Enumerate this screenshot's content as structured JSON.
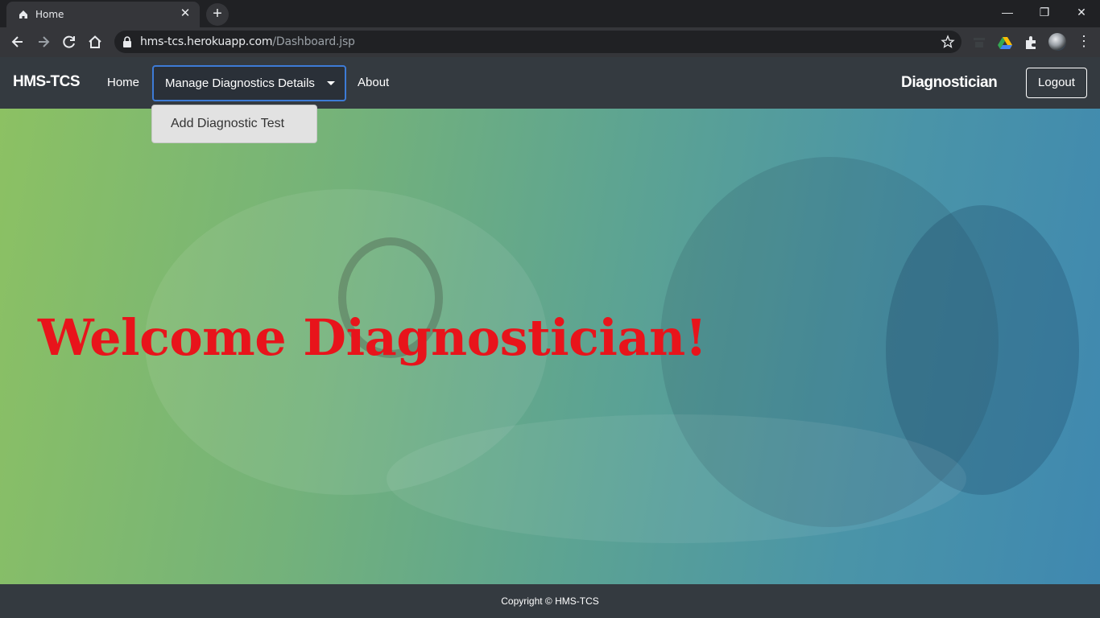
{
  "browser": {
    "tab_title": "Home",
    "url_host": "hms-tcs.herokuapp.com",
    "url_path": "/Dashboard.jsp",
    "icons": [
      "home-icon",
      "close-icon",
      "plus-icon",
      "back-icon",
      "forward-icon",
      "reload-icon",
      "lock-icon",
      "star-icon",
      "extensions-icon",
      "profile-icon"
    ]
  },
  "navbar": {
    "brand": "HMS-TCS",
    "home": "Home",
    "manage_dropdown": "Manage Diagnostics Details",
    "about": "About",
    "role": "Diagnostician",
    "logout": "Logout"
  },
  "dropdown_menu": {
    "items": [
      "Add Diagnostic Test"
    ]
  },
  "hero": {
    "welcome": "Welcome Diagnostician!",
    "welcome_color": "#e8141b"
  },
  "footer": {
    "copyright": "Copyright © HMS-TCS"
  }
}
